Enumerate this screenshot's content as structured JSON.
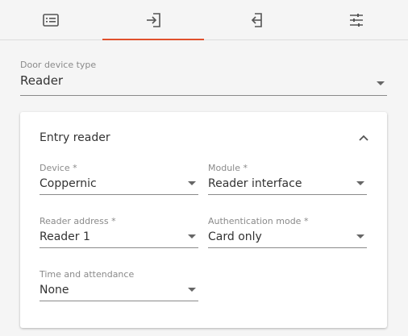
{
  "tabs": [
    {
      "icon": "list-icon",
      "active": false
    },
    {
      "icon": "entry-icon",
      "active": true
    },
    {
      "icon": "exit-icon",
      "active": false
    },
    {
      "icon": "settings-sliders-icon",
      "active": false
    }
  ],
  "accent_color": "#e0502d",
  "door_device_type": {
    "label": "Door device type",
    "value": "Reader"
  },
  "card": {
    "title": "Entry reader",
    "fields": {
      "device": {
        "label": "Device *",
        "value": "Coppernic"
      },
      "module": {
        "label": "Module *",
        "value": "Reader interface"
      },
      "reader_address": {
        "label": "Reader address *",
        "value": "Reader 1"
      },
      "authentication_mode": {
        "label": "Authentication mode *",
        "value": "Card only"
      },
      "time_and_attendance": {
        "label": "Time and attendance",
        "value": "None"
      }
    }
  }
}
